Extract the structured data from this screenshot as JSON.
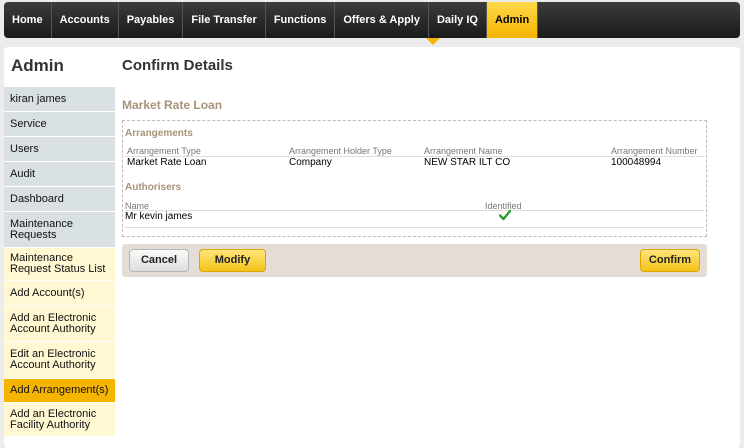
{
  "nav": {
    "items": [
      "Home",
      "Accounts",
      "Payables",
      "File Transfer",
      "Functions",
      "Offers & Apply",
      "Daily IQ",
      "Admin"
    ],
    "active": "Admin"
  },
  "sidebar": {
    "title": "Admin",
    "items": [
      {
        "label": "kiran james",
        "style": "grey"
      },
      {
        "label": "Service",
        "style": "grey"
      },
      {
        "label": "Users",
        "style": "grey"
      },
      {
        "label": "Audit",
        "style": "grey"
      },
      {
        "label": "Dashboard",
        "style": "grey"
      },
      {
        "label": "Maintenance Requests",
        "style": "grey"
      },
      {
        "label": "Maintenance Request Status List",
        "style": "yellow"
      },
      {
        "label": "Add Account(s)",
        "style": "yellow"
      },
      {
        "label": "Add an Electronic Account Authority",
        "style": "yellow"
      },
      {
        "label": "Edit an Electronic Account Authority",
        "style": "yellow"
      },
      {
        "label": "Add Arrangement(s)",
        "style": "active"
      },
      {
        "label": "Add an Electronic Facility Authority",
        "style": "yellow"
      }
    ]
  },
  "main": {
    "page_title": "Confirm Details",
    "section_title": "Market Rate Loan",
    "arrangements": {
      "title": "Arrangements",
      "headers": {
        "type": "Arrangement Type",
        "holder_type": "Arrangement Holder Type",
        "name": "Arrangement Name",
        "number": "Arrangement Number"
      },
      "row": {
        "type": "Market Rate Loan",
        "holder_type": "Company",
        "name": "NEW STAR ILT CO",
        "number": "100048994"
      }
    },
    "authorisers": {
      "title": "Authorisers",
      "headers": {
        "name": "Name",
        "identified": "Identified"
      },
      "row": {
        "name": "Mr kevin james",
        "identified": true,
        "identified_icon": "check-icon"
      }
    }
  },
  "actions": {
    "cancel": "Cancel",
    "modify": "Modify",
    "confirm": "Confirm"
  },
  "colors": {
    "accent": "#f5b400",
    "check": "#2a9d2a",
    "section_title": "#a89478"
  }
}
